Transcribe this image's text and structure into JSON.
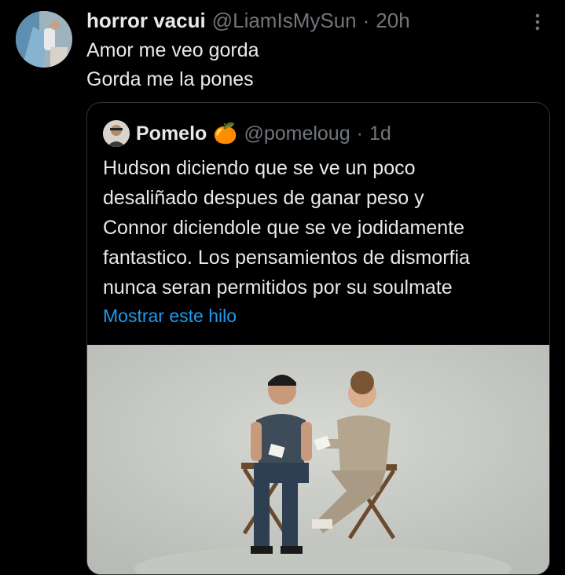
{
  "tweet": {
    "display_name": "horror vacui",
    "handle": "@LiamIsMySun",
    "separator": "·",
    "time": "20h",
    "lines": [
      "Amor me veo gorda",
      "Gorda me la pones"
    ],
    "avatar_icon": "profile-photo",
    "more_icon": "more-vertical-icon"
  },
  "quote": {
    "display_name": "Pomelo",
    "emoji": "🍊",
    "handle": "@pomeloug",
    "separator": "·",
    "time": "1d",
    "lines": [
      "Hudson diciendo que se ve un poco",
      "desaliñado despues de ganar peso y",
      "Connor diciendole que se ve jodidamente",
      "fantastico. Los pensamientos de dismorfia",
      "nunca seran permitidos por su soulmate"
    ],
    "show_thread": "Mostrar este hilo",
    "media_description_icon": "photo-two-men-in-directors-chairs"
  },
  "colors": {
    "background": "#000000",
    "text": "#e7e9ea",
    "muted": "#71767b",
    "link": "#1d9bf0",
    "border": "#2f3336"
  }
}
